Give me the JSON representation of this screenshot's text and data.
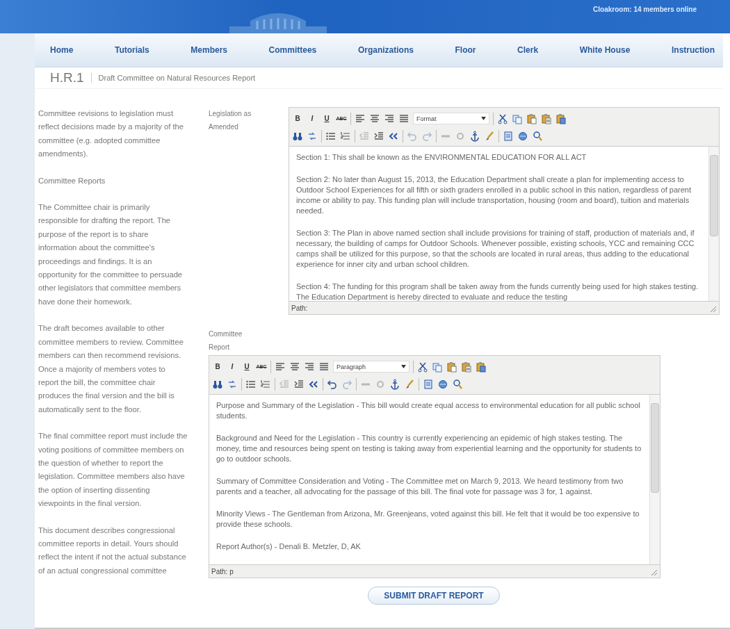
{
  "header": {
    "online_status": "Cloakroom: 14 members online"
  },
  "nav": [
    "Home",
    "Tutorials",
    "Members",
    "Committees",
    "Organizations",
    "Floor",
    "Clerk",
    "White House",
    "Instruction"
  ],
  "title": {
    "bill": "H.R.1",
    "subtitle": "Draft Committee on Natural Resources Report"
  },
  "sidebar": [
    "Committee revisions to legislation must reflect decisions made by a majority of the committee (e.g. adopted committee amendments).",
    "Committee Reports",
    "The Committee chair is primarily responsible for drafting the report. The purpose of the report is to share information about the committee's proceedings and findings. It is an opportunity for the committee to persuade other legislators that committee members have done their homework.",
    "The draft becomes available to other committee members to review. Committee members can then recommend revisions. Once a majority of members votes to report the bill, the committee chair produces the final version and the bill is automatically sent to the floor.",
    "The final committee report must include the voting positions of committee members on the question of whether to report the legislation. Committee members also have the option of inserting dissenting viewpoints in the final version.",
    "This document describes congressional committee reports in detail. Yours should reflect the intent if not the actual substance of an actual congressional committee"
  ],
  "editors": [
    {
      "label": "Legislation as Amended",
      "toolbar_text": [
        "B",
        "I",
        "U",
        "ABC"
      ],
      "format": "Format",
      "path": "Path:",
      "undo_disabled": true,
      "paragraphs": [
        "Section 1: This shall be known as the ENVIRONMENTAL EDUCATION FOR ALL ACT",
        "Section 2: No later than August 15, 2013, the Education Department shall create a plan for implementing access to Outdoor School Experiences for all fifth or sixth graders enrolled in a public school in this nation, regardless of parent income or ability to pay. This funding plan will include transportation, housing (room and board), tuition and materials needed.",
        "Section 3: The Plan in above named section shall include provisions for training of staff, production of materials and, if necessary, the building of camps for Outdoor Schools. Whenever possible, existing schools, YCC and remaining CCC camps shall be utilized for this purpose, so that the schools are located in rural areas, thus adding to the educational experience for inner city and urban school children.",
        "Section 4: The funding for this program shall be taken away from the funds currently being used for high stakes testing. The Education Department is hereby directed to evaluate and reduce the testing"
      ]
    },
    {
      "label": "Committee Report",
      "toolbar_text": [
        "B",
        "I",
        "U",
        "ABC"
      ],
      "format": "Paragraph",
      "path": "Path: p",
      "undo_disabled": false,
      "paragraphs": [
        "Purpose and Summary of the Legislation - This bill would create equal access to environmental education for all public school students.",
        "Background and Need for the Legislation - This country is currently experiencing an epidemic of high stakes testing.  The money, time and resources being spent on testing is taking away from experiential learning and the opportunity for students to go to outdoor schools.",
        "Summary of Committee Consideration and Voting - The Committee met on March 9, 2013.  We heard testimony from two parents and a teacher, all advocating for the passage of this bill.  The final vote for passage was 3 for, 1 against.",
        "Minority Views - The Gentleman from Arizona, Mr. Greenjeans, voted against this bill.  He felt that it would be too expensive to provide these schools.",
        "Report Author(s) - Denali B. Metzler, D, AK"
      ]
    }
  ],
  "submit": "SUBMIT DRAFT REPORT"
}
